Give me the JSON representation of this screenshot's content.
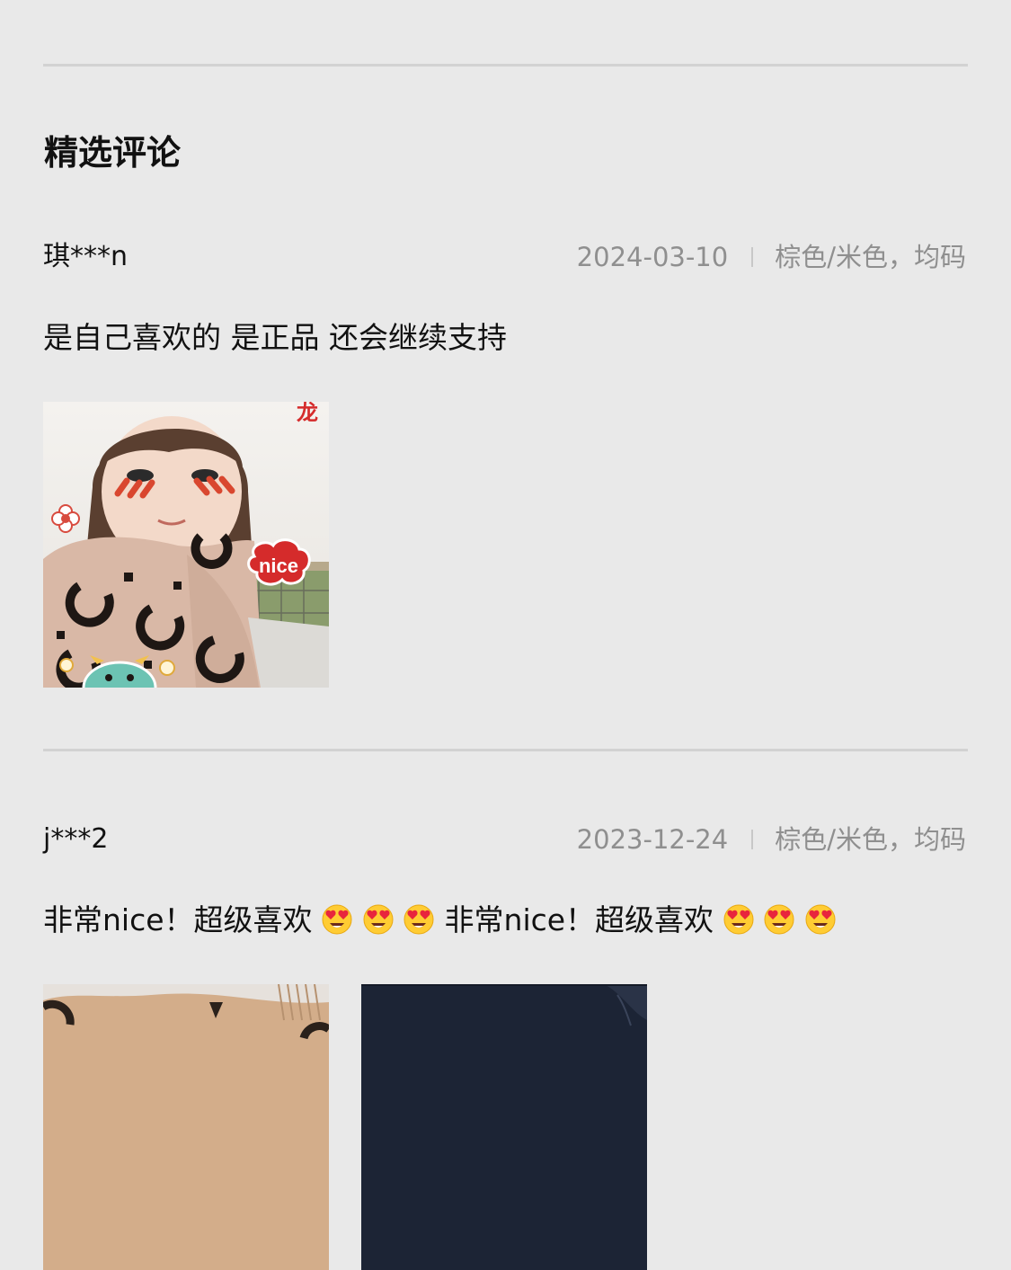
{
  "section": {
    "title": "精选评论"
  },
  "reviews": [
    {
      "user": "琪***n",
      "date": "2024-03-10",
      "variant": "棕色/米色，均码",
      "text": "是自己喜欢的 是正品 还会继续支持",
      "photo_count": 1
    },
    {
      "user": "j***2",
      "date": "2023-12-24",
      "variant": "棕色/米色，均码",
      "text_parts": [
        "非常nice！超级喜欢",
        " 非常nice！超级喜欢"
      ],
      "emoji": "heart-eyes-emoji",
      "emoji_repeat": 3,
      "photo_count": 2
    }
  ],
  "photo_stickers": {
    "nice": "nice",
    "long": "龙"
  },
  "colors": {
    "background": "#e9e9e9",
    "divider": "#d2d2d2",
    "meta_text": "#8f8f8f",
    "body_text": "#111111"
  }
}
